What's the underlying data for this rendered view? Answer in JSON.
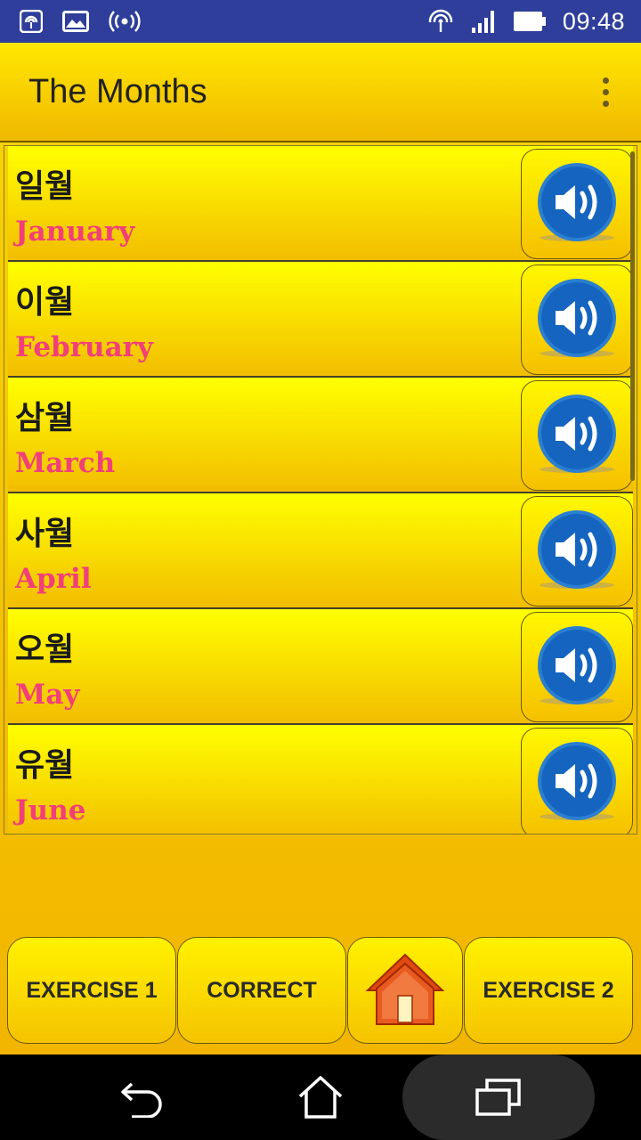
{
  "status_bar": {
    "left_icons": [
      "hotspot-icon",
      "image-notification-icon",
      "broadcast-icon"
    ],
    "right_icons": [
      "wifi-icon",
      "signal-icon",
      "battery-icon"
    ],
    "time": "09:48",
    "color": "#2e3e9a"
  },
  "app_bar": {
    "title": "The Months",
    "menu_icon": "overflow-menu-icon"
  },
  "months": [
    {
      "korean": "일월",
      "english": "January"
    },
    {
      "korean": "이월",
      "english": "February"
    },
    {
      "korean": "삼월",
      "english": "March"
    },
    {
      "korean": "사월",
      "english": "April"
    },
    {
      "korean": "오월",
      "english": "May"
    },
    {
      "korean": "유월",
      "english": "June"
    }
  ],
  "toolbar": {
    "exercise1_label": "EXERCISE 1",
    "correct_label": "CORRECT",
    "home_icon": "home-icon",
    "exercise2_label": "EXERCISE 2"
  },
  "nav_bar": {
    "icons": [
      "back-icon",
      "home-nav-icon",
      "recents-icon"
    ]
  },
  "colors": {
    "accent_yellow": "#ffe800",
    "english_text": "#f23f7a",
    "speaker_blue": "#1565c0"
  }
}
